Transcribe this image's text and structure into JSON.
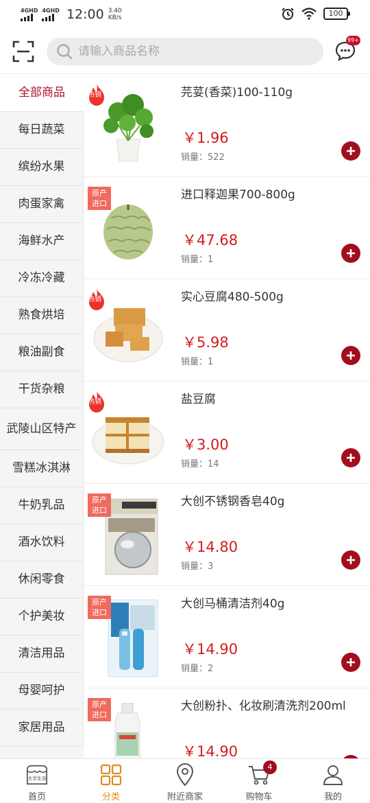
{
  "status_bar": {
    "sim1": "4GHD",
    "sim2": "4GHD",
    "time": "12:00",
    "speed_value": "3.40",
    "speed_unit": "KB/s",
    "battery": "100"
  },
  "header": {
    "search_placeholder": "请输入商品名称",
    "message_badge": "99+"
  },
  "sidebar": {
    "items": [
      {
        "label": "全部商品",
        "active": true
      },
      {
        "label": "每日蔬菜"
      },
      {
        "label": "缤纷水果"
      },
      {
        "label": "肉蛋家禽"
      },
      {
        "label": "海鲜水产"
      },
      {
        "label": "冷冻冷藏"
      },
      {
        "label": "熟食烘培"
      },
      {
        "label": "粮油副食"
      },
      {
        "label": "干货杂粮"
      },
      {
        "label": "武陵山区特产"
      },
      {
        "label": "雪糕冰淇淋"
      },
      {
        "label": "牛奶乳品"
      },
      {
        "label": "酒水饮料"
      },
      {
        "label": "休闲零食"
      },
      {
        "label": "个护美妆"
      },
      {
        "label": "清洁用品"
      },
      {
        "label": "母婴呵护"
      },
      {
        "label": "家居用品"
      }
    ]
  },
  "products": [
    {
      "name": "芫荽(香菜)100-110g",
      "price": "￥1.96",
      "sales": "销量：522",
      "tag": "热销"
    },
    {
      "name": "进口释迦果700-800g",
      "price": "￥47.68",
      "sales": "销量：1",
      "tag_line1": "原产",
      "tag_line2": "进口"
    },
    {
      "name": "实心豆腐480-500g",
      "price": "￥5.98",
      "sales": "销量：1",
      "tag": "热销"
    },
    {
      "name": "盐豆腐",
      "price": "￥3.00",
      "sales": "销量：14",
      "tag": "热销"
    },
    {
      "name": "大创不锈钢香皂40g",
      "price": "￥14.80",
      "sales": "销量：3",
      "tag_line1": "原产",
      "tag_line2": "进口"
    },
    {
      "name": "大创马桶清洁剂40g",
      "price": "￥14.90",
      "sales": "销量：2",
      "tag_line1": "原产",
      "tag_line2": "进口"
    },
    {
      "name": "大创粉扑、化妆刷清洗剂200ml",
      "price": "￥14.90",
      "sales": "",
      "tag_line1": "原产",
      "tag_line2": "进口"
    }
  ],
  "tab_bar": {
    "home": "首页",
    "home_logo_text": "大学生活",
    "category": "分类",
    "nearby": "附近商家",
    "cart": "购物车",
    "cart_badge": "4",
    "mine": "我的"
  },
  "colors": {
    "accent": "#a10f1e",
    "price": "#d41c1c",
    "active_tab": "#e08a1c",
    "import_tag": "#f06a5e"
  }
}
